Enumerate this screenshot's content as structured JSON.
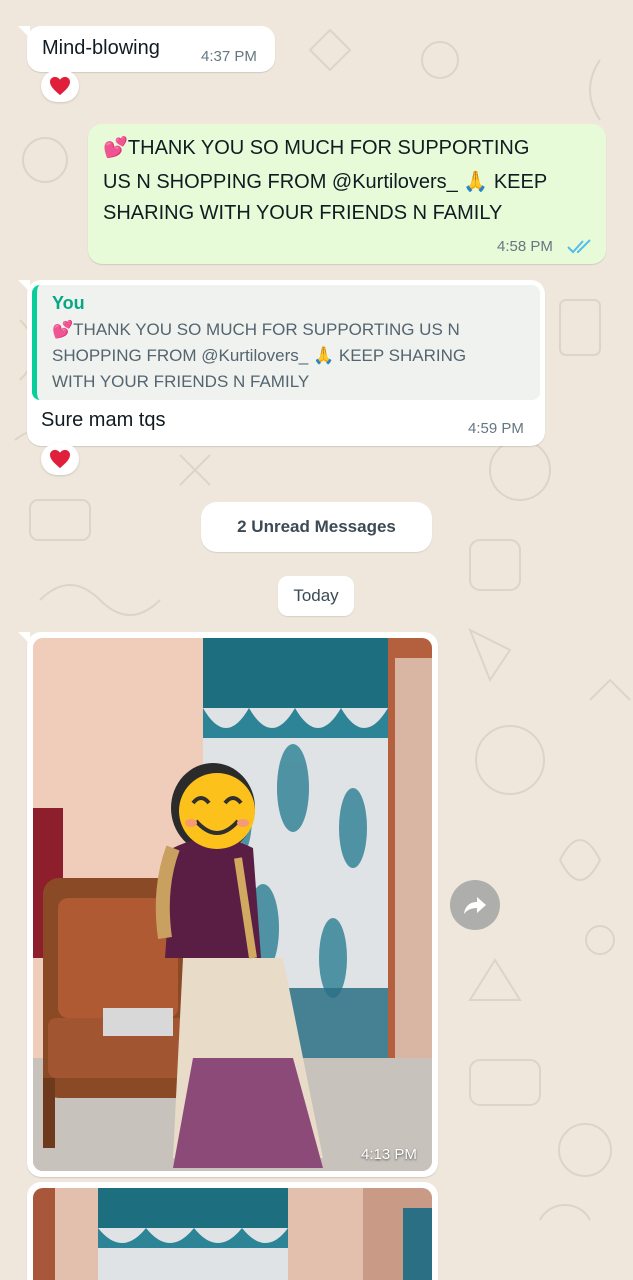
{
  "chat": {
    "messages": [
      {
        "id": "m1",
        "direction": "incoming",
        "text": "Mind-blowing",
        "time": "4:37 PM",
        "reaction": "heart-icon"
      },
      {
        "id": "m2",
        "direction": "outgoing",
        "lines": [
          "💕THANK YOU SO MUCH FOR SUPPORTING",
          "US N SHOPPING FROM @Kurtilovers_ 🙏 KEEP",
          "SHARING WITH YOUR FRIENDS N FAMILY"
        ],
        "time": "4:58 PM",
        "status": "read"
      },
      {
        "id": "m3",
        "direction": "incoming",
        "quote": {
          "author": "You",
          "lines": [
            "💕THANK YOU SO MUCH FOR SUPPORTING US N",
            "SHOPPING FROM @Kurtilovers_ 🙏 KEEP SHARING",
            "WITH YOUR FRIENDS N FAMILY"
          ]
        },
        "text": "Sure mam tqs",
        "time": "4:59 PM",
        "reaction": "heart-icon"
      },
      {
        "id": "m4",
        "direction": "incoming",
        "type": "image",
        "time": "4:13 PM"
      }
    ],
    "unread_banner": "2 Unread Messages",
    "date_chip": "Today"
  },
  "icons": {
    "reaction": "heart-icon",
    "read_receipt": "double-check-icon",
    "forward": "forward-icon",
    "emoji_sticker": "smiling-face-emoji-icon"
  },
  "colors": {
    "wallpaper": "#efe7dc",
    "incoming_bubble": "#ffffff",
    "outgoing_bubble": "#e7fbd8",
    "quote_accent": "#06cf9c",
    "read_ticks": "#53bdeb",
    "reaction_heart": "#e0203b"
  }
}
